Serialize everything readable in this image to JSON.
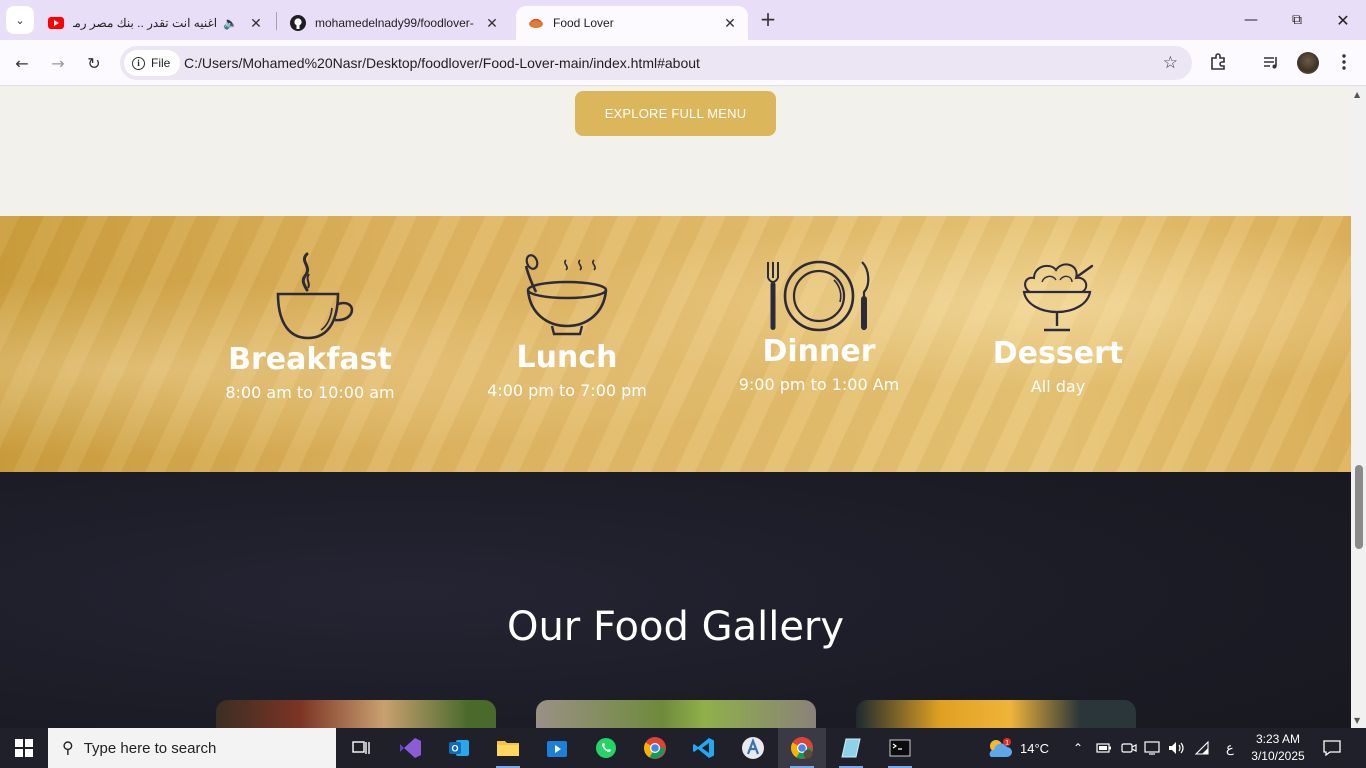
{
  "browser": {
    "tabs": [
      {
        "title": "اغنيه انت تقدر .. بنك مصر رمد",
        "audio": true
      },
      {
        "title": "mohamedelnady99/foodlover-"
      },
      {
        "title": "Food Lover",
        "active": true
      }
    ],
    "address": {
      "scheme_label": "File",
      "url": "C:/Users/Mohamed%20Nasr/Desktop/foodlover/Food-Lover-main/index.html#about"
    }
  },
  "page": {
    "explore_button": "EXPLORE FULL MENU",
    "hours": [
      {
        "name": "Breakfast",
        "time": "8:00 am to 10:00 am",
        "icon": "coffee-cup-icon"
      },
      {
        "name": "Lunch",
        "time": "4:00 pm to 7:00 pm",
        "icon": "soup-bowl-icon"
      },
      {
        "name": "Dinner",
        "time": "9:00 pm to 1:00 Am",
        "icon": "plate-cutlery-icon"
      },
      {
        "name": "Dessert",
        "time": "All day",
        "icon": "ice-cream-icon"
      }
    ],
    "gallery_title": "Our Food Gallery"
  },
  "taskbar": {
    "search_placeholder": "Type here to search",
    "weather": {
      "temp": "14°C",
      "badge": "1"
    },
    "lang": "ع",
    "time": "3:23 AM",
    "date": "3/10/2025"
  },
  "colors": {
    "accent_gold": "#dcb65a",
    "dark_section": "#1b1b25",
    "tab_strip": "#e8def7"
  }
}
